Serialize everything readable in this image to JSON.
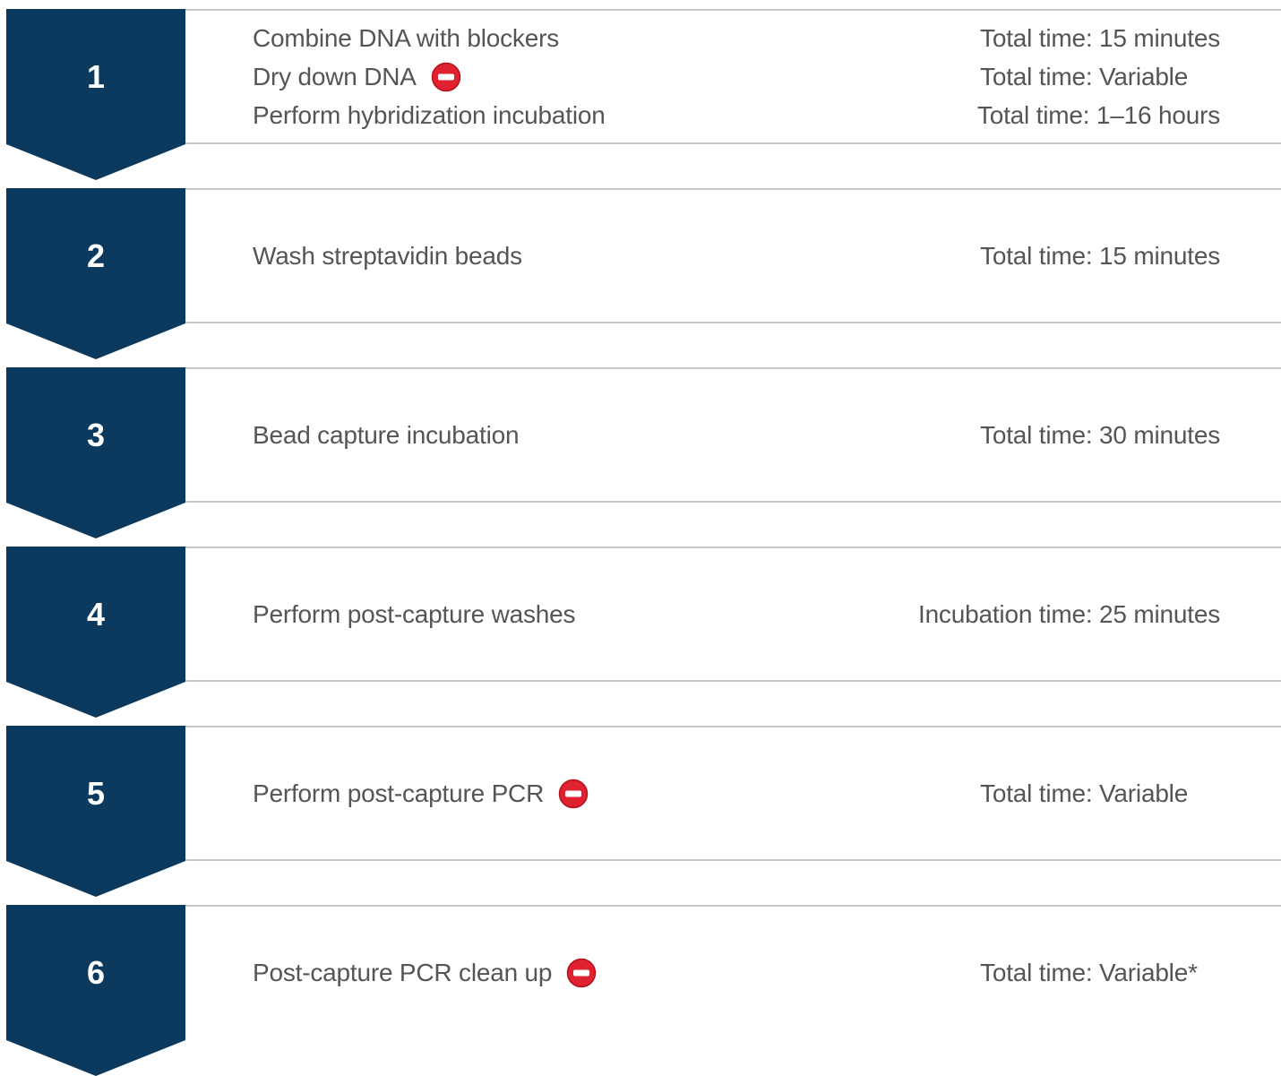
{
  "colors": {
    "chevron": "#0b3a5e",
    "text": "#555555",
    "rule": "#c8c8c8",
    "stop_icon": "#e02230"
  },
  "steps": [
    {
      "number": "1",
      "rows": [
        {
          "task": "Combine DNA with blockers",
          "time": "Total time: 15 minutes",
          "stop": false
        },
        {
          "task": "Dry down DNA",
          "time": "Total time: Variable",
          "stop": true
        },
        {
          "task": "Perform hybridization incubation",
          "time": "Total time: 1–16 hours",
          "stop": false
        }
      ]
    },
    {
      "number": "2",
      "rows": [
        {
          "task": "Wash streptavidin beads",
          "time": "Total time: 15 minutes",
          "stop": false
        }
      ]
    },
    {
      "number": "3",
      "rows": [
        {
          "task": "Bead capture incubation",
          "time": "Total time: 30 minutes",
          "stop": false
        }
      ]
    },
    {
      "number": "4",
      "rows": [
        {
          "task": "Perform post-capture washes",
          "time": "Incubation time: 25 minutes",
          "stop": false
        }
      ]
    },
    {
      "number": "5",
      "rows": [
        {
          "task": "Perform post-capture PCR",
          "time": "Total time: Variable",
          "stop": true
        }
      ]
    },
    {
      "number": "6",
      "rows": [
        {
          "task": "Post-capture PCR clean up",
          "time": "Total time: Variable*",
          "stop": true
        }
      ]
    }
  ]
}
